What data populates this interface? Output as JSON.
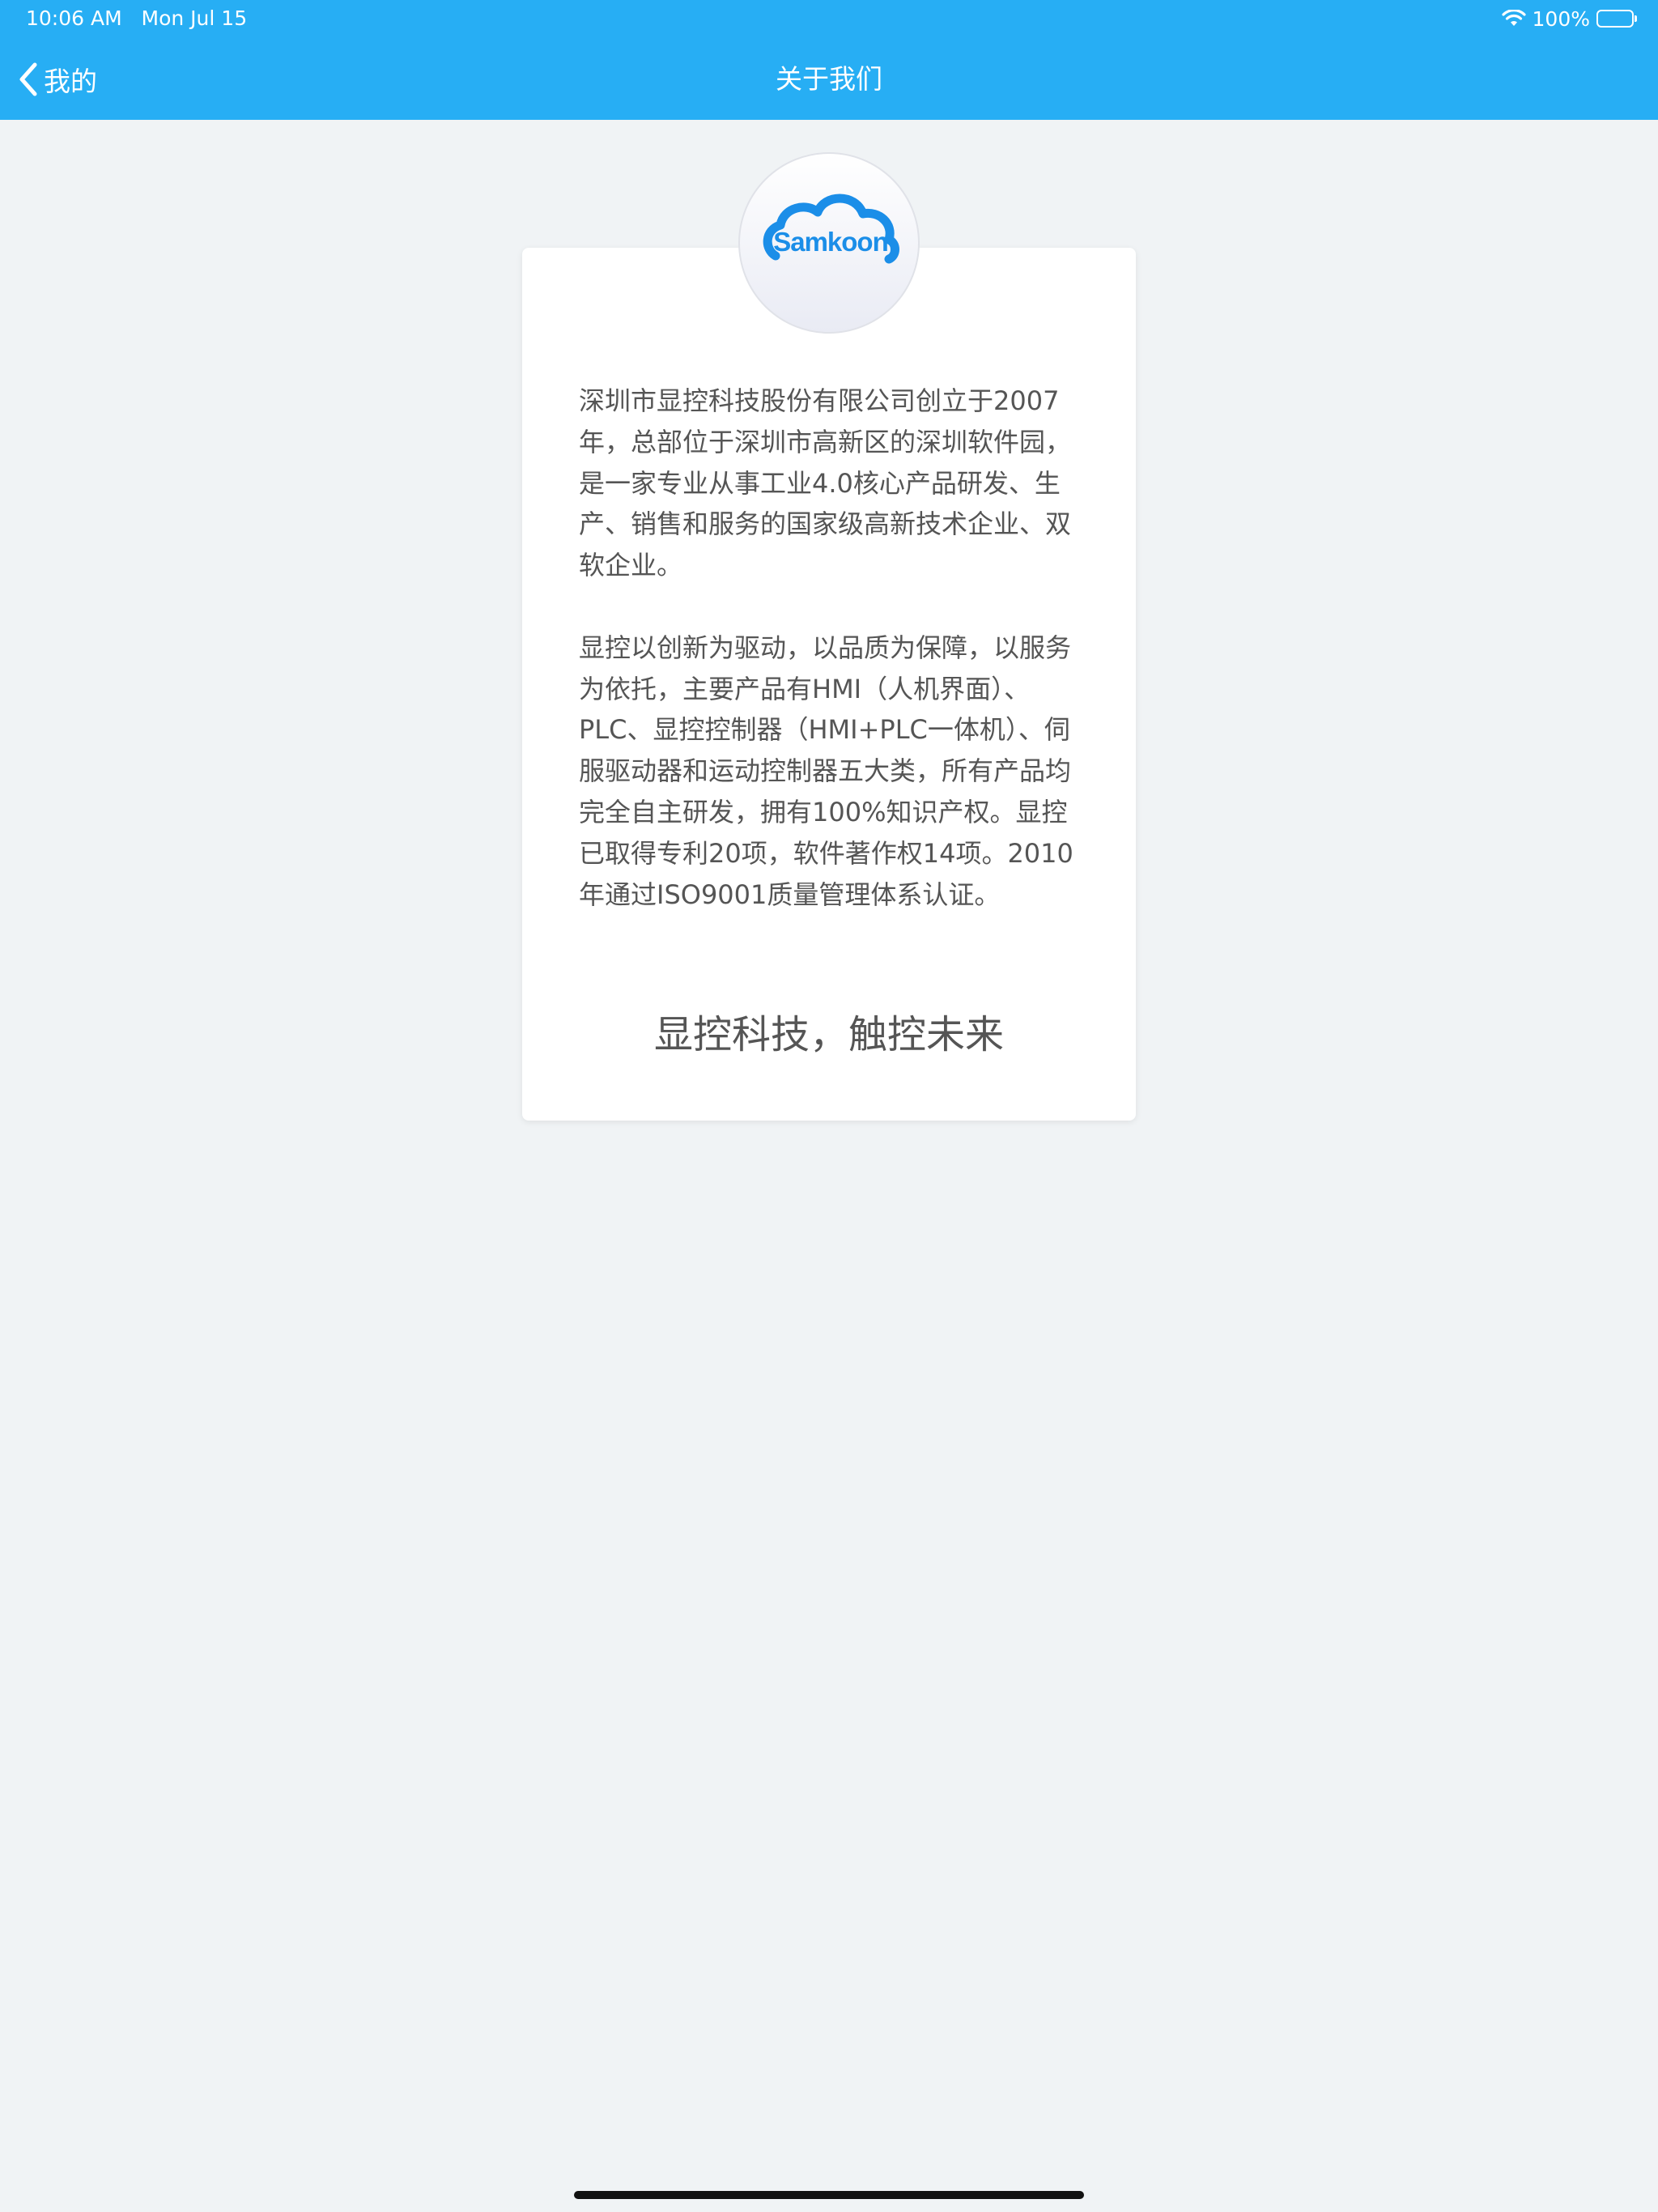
{
  "status_bar": {
    "time": "10:06 AM",
    "date": "Mon Jul 15",
    "battery": "100%",
    "battery_level": 1.0,
    "icons": [
      "wifi-icon",
      "battery-icon"
    ]
  },
  "nav": {
    "back_label": "我的",
    "back_icon": "chevron-left-icon",
    "title": "关于我们"
  },
  "logo": {
    "text": "Samkoon",
    "icon": "cloud-logo-icon"
  },
  "about": {
    "paragraphs": [
      "深圳市显控科技股份有限公司创立于2007年，总部位于深圳市高新区的深圳软件园，是一家专业从事工业4.0核心产品研发、生产、销售和服务的国家级高新技术企业、双软企业。",
      "显控以创新为驱动，以品质为保障，以服务为依托，主要产品有HMI（人机界面）、PLC、显控控制器（HMI+PLC一体机）、伺服驱动器和运动控制器五大类，所有产品均完全自主研发，拥有100%知识产权。显控已取得专利20项，软件著作权14项。2010年通过ISO9001质量管理体系认证。"
    ],
    "slogan": "显控科技，触控未来"
  },
  "colors": {
    "header": "#27aef4",
    "background": "#f0f3f5",
    "card": "#ffffff",
    "text": "#555555",
    "logo_blue": "#1b8ee8"
  }
}
